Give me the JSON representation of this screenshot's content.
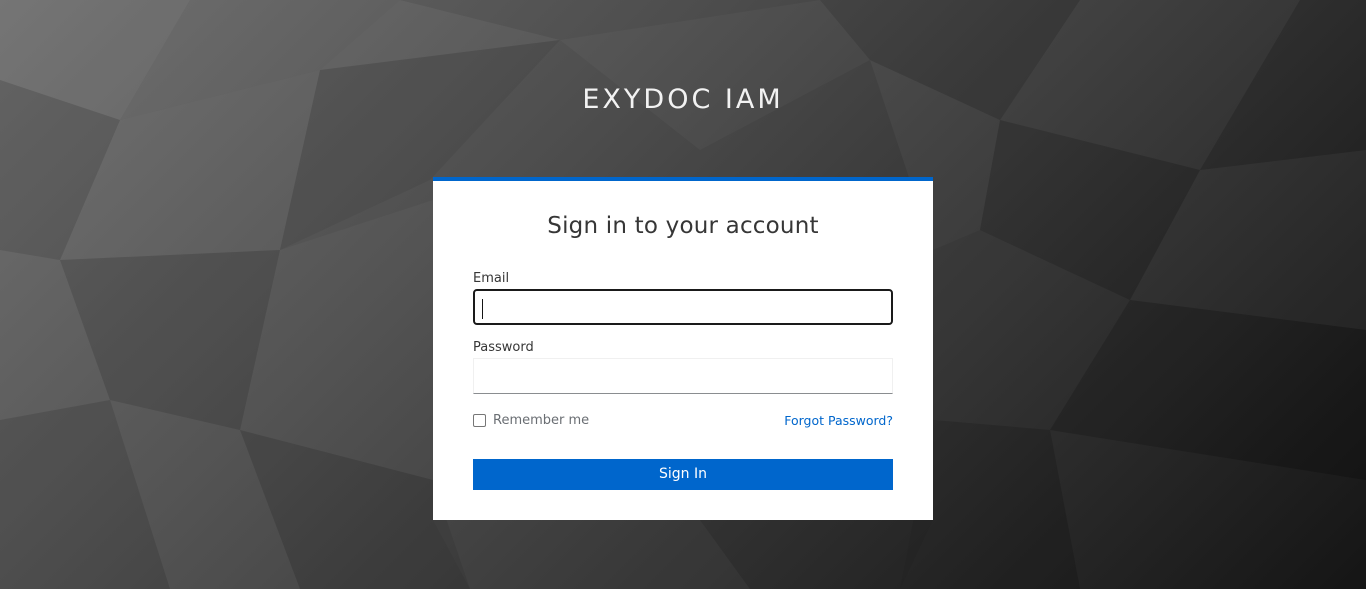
{
  "brand": {
    "title": "EXYDOC IAM"
  },
  "login": {
    "heading": "Sign in to your account",
    "email_label": "Email",
    "email_value": "",
    "password_label": "Password",
    "password_value": "",
    "remember_label": "Remember me",
    "remember_checked": false,
    "forgot_label": "Forgot Password?",
    "submit_label": "Sign In"
  },
  "colors": {
    "accent": "#0066cc",
    "card_background": "#ffffff",
    "background_dark": "#111111",
    "background_light": "#6b6b6b"
  }
}
